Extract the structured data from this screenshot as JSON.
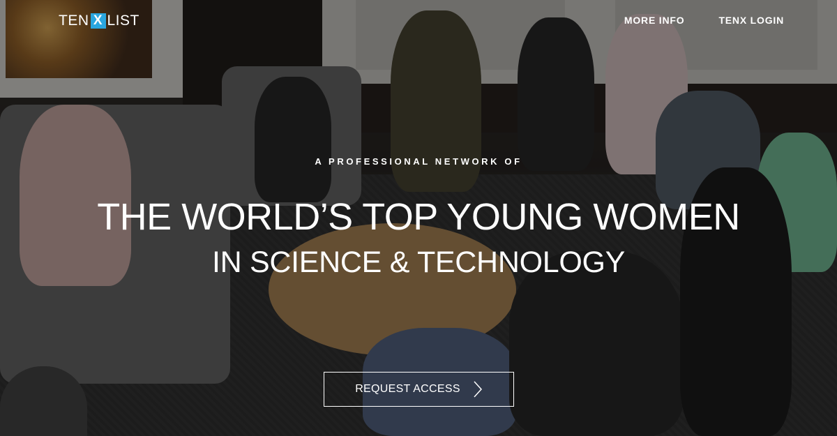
{
  "brand": {
    "logo_left": "TEN",
    "logo_x": "X",
    "logo_right": "LIST",
    "accent_color": "#2aa6df"
  },
  "nav": {
    "items": [
      {
        "label": "MORE INFO"
      },
      {
        "label": "TENX LOGIN"
      }
    ]
  },
  "hero": {
    "eyebrow": "A PROFESSIONAL NETWORK OF",
    "headline": "THE WORLD’S TOP YOUNG WOMEN",
    "subhead": "IN SCIENCE & TECHNOLOGY",
    "cta_label": "REQUEST ACCESS",
    "cta_icon": "chevron-right-icon"
  }
}
